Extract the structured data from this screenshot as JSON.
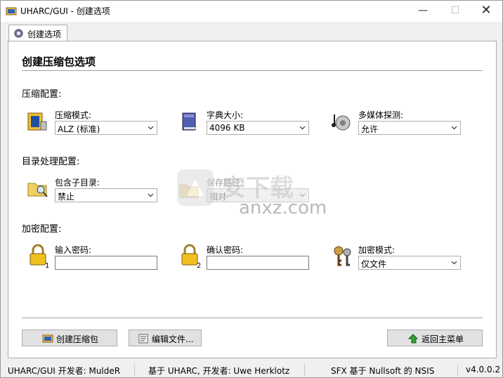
{
  "window": {
    "title": "UHARC/GUI - 创建选项"
  },
  "tab": {
    "label": "创建选项"
  },
  "page": {
    "title": "创建压缩包选项"
  },
  "compression": {
    "section": "压缩配置:",
    "mode": {
      "label": "压缩模式:",
      "value": "ALZ (标准)"
    },
    "dict": {
      "label": "字典大小:",
      "value": "4096 KB"
    },
    "multimedia": {
      "label": "多媒体探测:",
      "value": "允许"
    }
  },
  "directory": {
    "section": "目录处理配置:",
    "subdirs": {
      "label": "包含子目录:",
      "value": "禁止"
    },
    "savepath": {
      "label": "保存路径:",
      "value": "相对"
    }
  },
  "encryption": {
    "section": "加密配置:",
    "pwd": {
      "label": "输入密码:",
      "value": "",
      "badge": "1"
    },
    "confirm": {
      "label": "确认密码:",
      "value": "",
      "badge": "2"
    },
    "mode": {
      "label": "加密模式:",
      "value": "仅文件"
    }
  },
  "buttons": {
    "create": "创建压缩包",
    "edit": "编辑文件...",
    "back": "返回主菜单"
  },
  "watermark": {
    "text": "anxz.com"
  },
  "statusbar": {
    "author": "UHARC/GUI 开发者: MuldeR",
    "based": "基于 UHARC, 开发者: Uwe Herklotz",
    "sfx": "SFX 基于 Nullsoft 的 NSIS",
    "version": "v4.0.0.2"
  }
}
